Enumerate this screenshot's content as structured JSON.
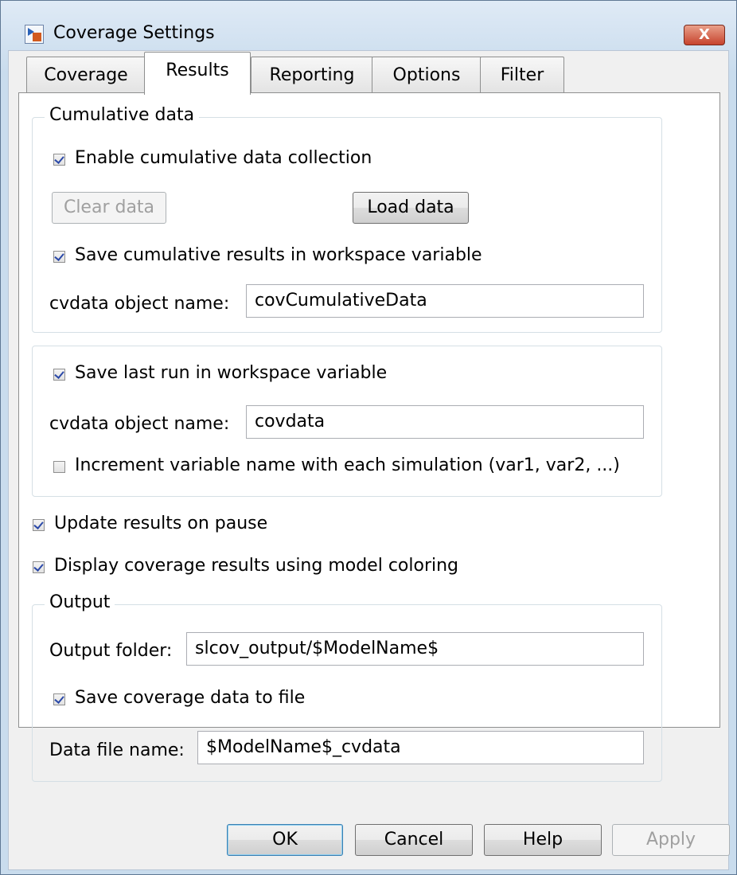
{
  "window": {
    "title": "Coverage Settings",
    "close_glyph": "X"
  },
  "tabs": [
    {
      "label": "Coverage"
    },
    {
      "label": "Results"
    },
    {
      "label": "Reporting"
    },
    {
      "label": "Options"
    },
    {
      "label": "Filter"
    }
  ],
  "active_tab": "Results",
  "cumulative": {
    "legend": "Cumulative data",
    "enable_label": "Enable cumulative data collection",
    "enable_checked": true,
    "clear_label": "Clear data",
    "load_label": "Load data",
    "save_label": "Save cumulative results in workspace variable",
    "save_checked": true,
    "name_label": "cvdata object name:",
    "name_value": "covCumulativeData"
  },
  "lastrun": {
    "save_label": "Save last run in workspace variable",
    "save_checked": true,
    "name_label": "cvdata object name:",
    "name_value": "covdata",
    "increment_label": "Increment variable name with each simulation (var1, var2, ...)",
    "increment_checked": false
  },
  "update_label": "Update results on pause",
  "update_checked": true,
  "display_label": "Display coverage results using model coloring",
  "display_checked": true,
  "output": {
    "legend": "Output",
    "folder_label": "Output folder:",
    "folder_value": "slcov_output/$ModelName$",
    "save_label": "Save coverage data to file",
    "save_checked": true,
    "file_label": "Data file name:",
    "file_value": "$ModelName$_cvdata"
  },
  "buttons": {
    "ok": "OK",
    "cancel": "Cancel",
    "help": "Help",
    "apply": "Apply"
  },
  "colors": {
    "title_bg": "#c9dced",
    "close_bg": "#c7432d",
    "default_button_border": "#3c7fb1"
  }
}
